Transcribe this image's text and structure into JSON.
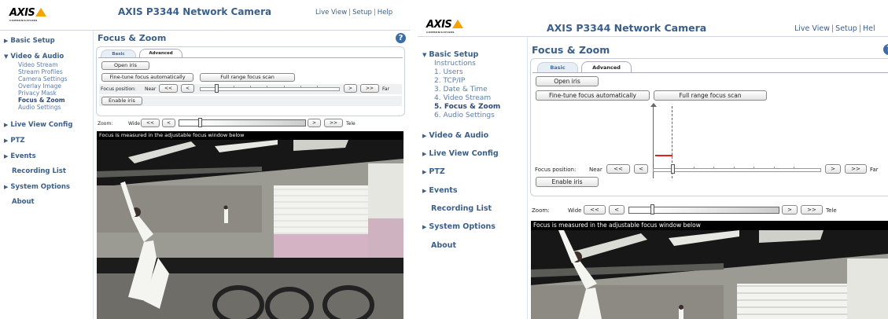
{
  "left": {
    "logo_text": "AXIS",
    "logo_sub": "COMMUNICATIONS",
    "title": "AXIS P3344 Network Camera",
    "links": [
      "Live View",
      "Setup",
      "Help"
    ],
    "nav": [
      {
        "label": "Basic Setup"
      },
      {
        "label": "Video & Audio",
        "expanded": true,
        "children": [
          "Video Stream",
          "Stream Profiles",
          "Camera Settings",
          "Overlay Image",
          "Privacy Mask",
          "Focus & Zoom",
          "Audio Settings"
        ],
        "active_child": "Focus & Zoom"
      },
      {
        "label": "Live View Config"
      },
      {
        "label": "PTZ"
      },
      {
        "label": "Events"
      },
      {
        "label": "Recording List",
        "no_arrow": true
      },
      {
        "label": "System Options"
      },
      {
        "label": "About",
        "no_arrow": true
      }
    ],
    "page_title": "Focus & Zoom",
    "help_icon": "?",
    "tabs": [
      "Basic",
      "Advanced"
    ],
    "open_iris": "Open iris",
    "fine_tune": "Fine-tune focus automatically",
    "full_range": "Full range focus scan",
    "focus_label": "Focus position:",
    "near": "Near",
    "far": "Far",
    "btn_ll": "<<",
    "btn_l": "<",
    "btn_r": ">",
    "btn_rr": ">>",
    "enable_iris": "Enable iris",
    "zoom_label": "Zoom:",
    "wide": "Wide",
    "tele": "Tele",
    "video_caption": "Focus is measured in the adjustable focus window below"
  },
  "right": {
    "logo_text": "AXIS",
    "logo_sub": "COMMUNICATIONS",
    "title": "AXIS P3344 Network Camera",
    "links": [
      "Live View",
      "Setup",
      "Hel"
    ],
    "nav": [
      {
        "label": "Basic Setup",
        "expanded": true,
        "children": [
          "Instructions",
          "1. Users",
          "2. TCP/IP",
          "3. Date & Time",
          "4. Video Stream",
          "5. Focus & Zoom",
          "6. Audio Settings"
        ],
        "active_child": "5. Focus & Zoom"
      },
      {
        "label": "Video & Audio"
      },
      {
        "label": "Live View Config"
      },
      {
        "label": "PTZ"
      },
      {
        "label": "Events"
      },
      {
        "label": "Recording List",
        "no_arrow": true
      },
      {
        "label": "System Options"
      },
      {
        "label": "About",
        "no_arrow": true
      }
    ],
    "page_title": "Focus & Zoom",
    "tabs": [
      "Basic",
      "Advanced"
    ],
    "open_iris": "Open iris",
    "fine_tune": "Fine-tune focus automatically",
    "full_range": "Full range focus scan",
    "focus_label": "Focus position:",
    "near": "Near",
    "far": "Far",
    "btn_ll": "<<",
    "btn_l": "<",
    "btn_r": ">",
    "btn_rr": ">>",
    "enable_iris": "Enable iris",
    "zoom_label": "Zoom:",
    "wide": "Wide",
    "tele": "Tele",
    "video_caption": "Focus is measured in the adjustable focus window below"
  },
  "colors": {
    "brand_blue": "#3a5f8a",
    "logo_yellow": "#f5a300",
    "focus_indicator": "#e02020"
  },
  "icons": [
    "help-icon",
    "arrow-right-icon",
    "arrow-down-icon"
  ]
}
